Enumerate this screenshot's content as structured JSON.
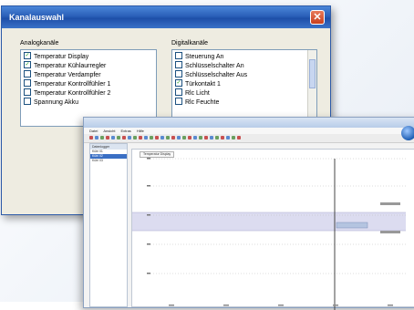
{
  "dialog": {
    "title": "Kanalauswahl",
    "analog_label": "Analogkanäle",
    "digital_label": "Digitalkanäle",
    "analog_items": [
      {
        "label": "Temperatur Display",
        "checked": true
      },
      {
        "label": "Temperatur Kühlaurregler",
        "checked": true
      },
      {
        "label": "Temperatur Verdampfer",
        "checked": false
      },
      {
        "label": "Temperatur Kontrollfühler 1",
        "checked": false
      },
      {
        "label": "Temperatur Kontrollfühler 2",
        "checked": false
      },
      {
        "label": "Spannung Akku",
        "checked": false
      }
    ],
    "digital_items": [
      {
        "label": "Steuerung An",
        "checked": false
      },
      {
        "label": "Schlüsselschalter An",
        "checked": false
      },
      {
        "label": "Schlüsselschalter Aus",
        "checked": false
      },
      {
        "label": "Türkontakt 1",
        "checked": true
      },
      {
        "label": "Rlc Licht",
        "checked": false
      },
      {
        "label": "Rlc Feuchte",
        "checked": false
      }
    ]
  },
  "app": {
    "menu": [
      "Datei",
      "Ansicht",
      "Extras",
      "Hilfe"
    ],
    "sidebar_header": "Datenlogger",
    "sidebar_rows": [
      "Kühl 01",
      "Kühl 02",
      "Kühl 03"
    ],
    "sidebar_selected": 1,
    "chart_header": "Temperatur Display",
    "band_label": "Grenzwert",
    "colors": {
      "band": "#c8c8e8",
      "marker": "#444444",
      "accent": "#3a6fc4"
    }
  }
}
